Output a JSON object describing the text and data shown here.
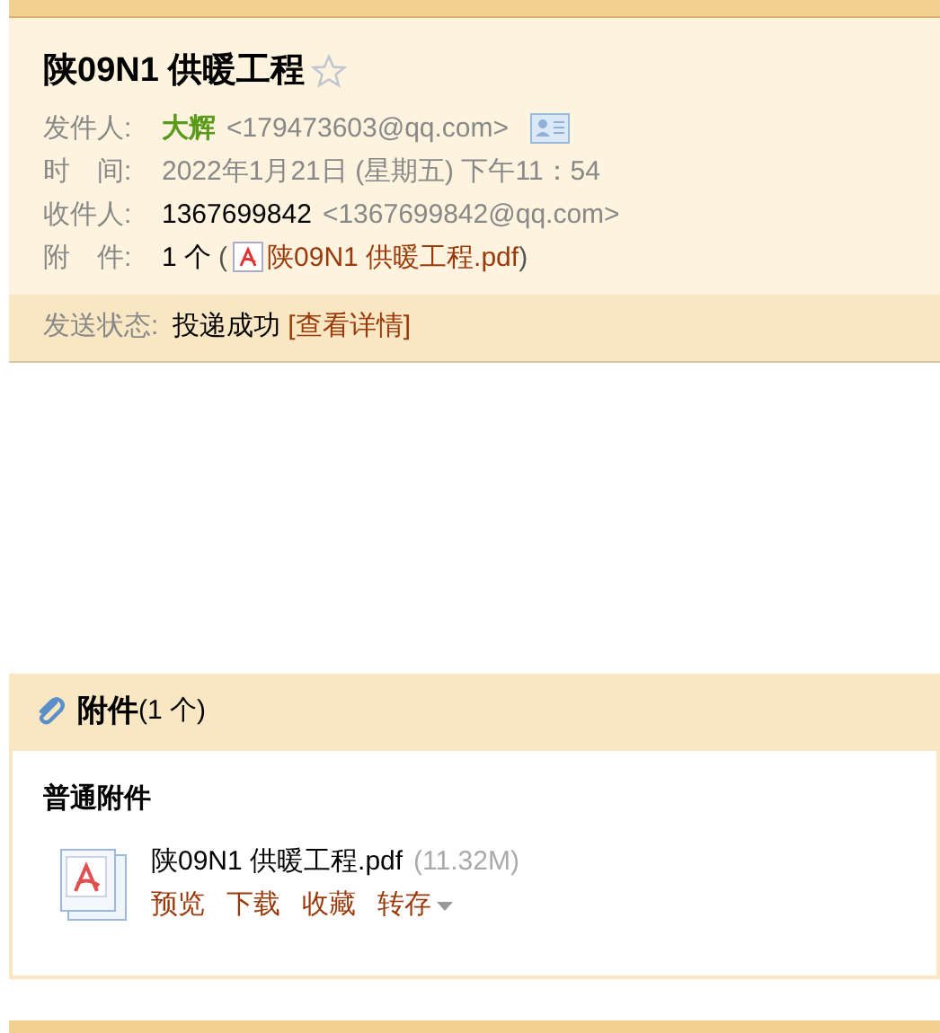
{
  "mail": {
    "subject": "陕09N1 供暖工程",
    "starred": false,
    "fields": [
      {
        "kind": "sender",
        "label": "发件人:",
        "name": "大辉",
        "address": "<179473603@qq.com>"
      },
      {
        "kind": "time",
        "label": "时　间:",
        "value": "2022年1月21日 (星期五) 下午11：54"
      },
      {
        "kind": "recipient",
        "label": "收件人:",
        "name": "1367699842",
        "address": "<1367699842@qq.com>"
      },
      {
        "kind": "attachment",
        "label": "附　件:",
        "count": "1 个",
        "open": "(",
        "file": "陕09N1 供暖工程.pdf",
        "close": ")"
      }
    ],
    "status": {
      "label": "发送状态:",
      "value": "投递成功",
      "link": "[查看详情]"
    }
  },
  "attachments": {
    "title": "附件",
    "count": "(1 个)",
    "group": "普通附件",
    "files": [
      {
        "name": "陕09N1 供暖工程.pdf",
        "size": "(11.32M)",
        "actions": [
          "预览",
          "下载",
          "收藏"
        ],
        "menu": "转存"
      }
    ]
  }
}
